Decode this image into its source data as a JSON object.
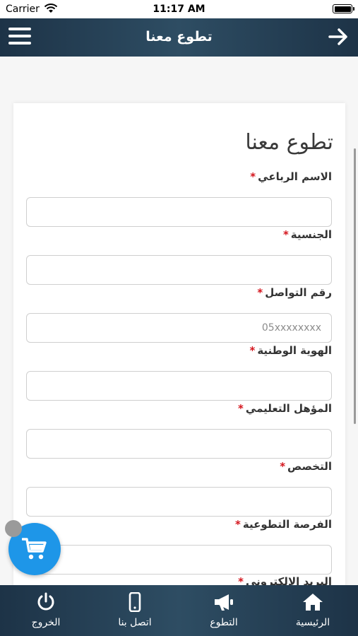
{
  "status_bar": {
    "carrier": "Carrier",
    "time": "11:17 AM"
  },
  "header": {
    "title": "تطوع معنا"
  },
  "form": {
    "title": "تطوع معنا",
    "required_marker": "*",
    "fields": [
      {
        "label": "الاسم الرباعي",
        "value": "",
        "placeholder": ""
      },
      {
        "label": "الجنسية",
        "value": "",
        "placeholder": ""
      },
      {
        "label": "رقم التواصل",
        "value": "",
        "placeholder": "05xxxxxxxx"
      },
      {
        "label": "الهوية الوطنية",
        "value": "",
        "placeholder": ""
      },
      {
        "label": "المؤهل التعليمي",
        "value": "",
        "placeholder": ""
      },
      {
        "label": "التخصص",
        "value": "",
        "placeholder": ""
      },
      {
        "label": "الفرصة التطوعية",
        "value": "",
        "placeholder": ""
      },
      {
        "label": "البريد الالكتروني",
        "value": "",
        "placeholder": ""
      }
    ]
  },
  "tab_bar": {
    "home": "الرئيسية",
    "volunteer": "التطوع",
    "contact": "اتصل بنا",
    "logout": "الخروج"
  },
  "icons": {
    "menu": "menu-icon",
    "back": "arrow-right-icon",
    "cart": "cart-icon",
    "home": "home-icon",
    "volunteer": "megaphone-icon",
    "contact": "phone-icon",
    "logout": "power-icon"
  },
  "colors": {
    "header_bg": "#243d52",
    "fab": "#1e96e8",
    "required": "#d4141c"
  }
}
